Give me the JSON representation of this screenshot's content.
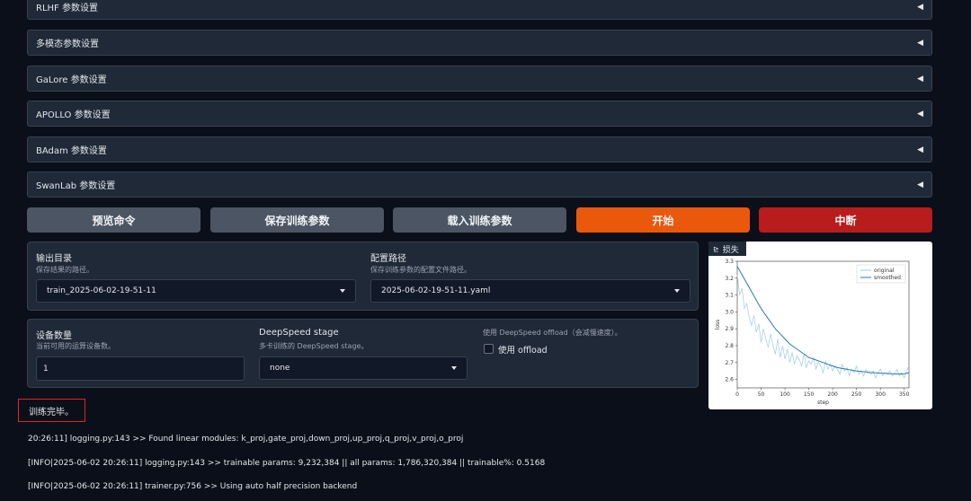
{
  "accordions": [
    {
      "label": "RLHF 参数设置"
    },
    {
      "label": "多模态参数设置"
    },
    {
      "label": "GaLore 参数设置"
    },
    {
      "label": "APOLLO 参数设置"
    },
    {
      "label": "BAdam 参数设置"
    },
    {
      "label": "SwanLab 参数设置"
    }
  ],
  "accordion_arrow": "◀",
  "buttons": {
    "preview": "预览命令",
    "save": "保存训练参数",
    "load": "载入训练参数",
    "start": "开始",
    "abort": "中断"
  },
  "output_dir": {
    "label": "输出目录",
    "info": "保存结果的路径。",
    "value": "train_2025-06-02-19-51-11"
  },
  "config_path": {
    "label": "配置路径",
    "info": "保存训练参数的配置文件路径。",
    "value": "2025-06-02-19-51-11.yaml"
  },
  "device_count": {
    "label": "设备数量",
    "info": "当前可用的运算设备数。",
    "value": "1"
  },
  "ds_stage": {
    "label": "DeepSpeed stage",
    "info": "多卡训练的 DeepSpeed stage。",
    "value": "none"
  },
  "ds_offload": {
    "info": "使用 DeepSpeed offload（会减慢速度）。",
    "label": "使用 offload"
  },
  "plot": {
    "tag": "损失"
  },
  "chart_data": {
    "type": "line",
    "xlabel": "step",
    "ylabel": "loss",
    "xlim": [
      0,
      360
    ],
    "ylim": [
      2.55,
      3.3
    ],
    "xticks": [
      0,
      50,
      100,
      150,
      200,
      250,
      300,
      350
    ],
    "yticks": [
      2.6,
      2.7,
      2.8,
      2.9,
      3.0,
      3.1,
      3.2,
      3.3
    ],
    "legend": "top-right",
    "series": [
      {
        "name": "original",
        "color": "#9ecae1",
        "x": [
          0,
          5,
          10,
          15,
          20,
          25,
          30,
          35,
          40,
          45,
          50,
          55,
          60,
          65,
          70,
          75,
          80,
          85,
          90,
          95,
          100,
          105,
          110,
          115,
          120,
          125,
          130,
          135,
          140,
          145,
          150,
          155,
          160,
          165,
          170,
          175,
          180,
          185,
          190,
          195,
          200,
          205,
          210,
          215,
          220,
          225,
          230,
          235,
          240,
          245,
          250,
          255,
          260,
          265,
          270,
          275,
          280,
          285,
          290,
          295,
          300,
          305,
          310,
          315,
          320,
          325,
          330,
          335,
          340,
          345,
          350,
          355,
          360
        ],
        "values": [
          3.22,
          3.1,
          3.14,
          3.02,
          3.05,
          2.97,
          2.92,
          2.98,
          2.88,
          2.93,
          2.82,
          2.9,
          2.84,
          2.79,
          2.87,
          2.8,
          2.75,
          2.84,
          2.73,
          2.8,
          2.72,
          2.78,
          2.7,
          2.76,
          2.69,
          2.74,
          2.72,
          2.68,
          2.75,
          2.67,
          2.71,
          2.69,
          2.73,
          2.66,
          2.7,
          2.68,
          2.64,
          2.71,
          2.66,
          2.69,
          2.65,
          2.68,
          2.66,
          2.63,
          2.69,
          2.65,
          2.67,
          2.62,
          2.66,
          2.64,
          2.68,
          2.63,
          2.65,
          2.62,
          2.66,
          2.64,
          2.63,
          2.65,
          2.61,
          2.64,
          2.66,
          2.62,
          2.64,
          2.63,
          2.65,
          2.62,
          2.63,
          2.66,
          2.62,
          2.64,
          2.61,
          2.65,
          2.68
        ]
      },
      {
        "name": "smoothed",
        "color": "#2878b5",
        "x": [
          0,
          10,
          20,
          30,
          40,
          50,
          60,
          70,
          80,
          90,
          100,
          110,
          120,
          130,
          140,
          150,
          160,
          170,
          180,
          190,
          200,
          210,
          220,
          230,
          240,
          250,
          260,
          270,
          280,
          290,
          300,
          310,
          320,
          330,
          340,
          350,
          360
        ],
        "values": [
          3.27,
          3.22,
          3.17,
          3.12,
          3.07,
          3.02,
          2.98,
          2.94,
          2.9,
          2.87,
          2.84,
          2.81,
          2.79,
          2.77,
          2.75,
          2.73,
          2.72,
          2.71,
          2.7,
          2.69,
          2.68,
          2.67,
          2.665,
          2.66,
          2.655,
          2.65,
          2.647,
          2.644,
          2.641,
          2.639,
          2.637,
          2.636,
          2.634,
          2.633,
          2.632,
          2.633,
          2.64
        ]
      }
    ]
  },
  "status": "训练完毕。",
  "logs": [
    "20:26:11] logging.py:143 >> Found linear modules: k_proj,gate_proj,down_proj,up_proj,q_proj,v_proj,o_proj",
    "[INFO|2025-06-02 20:26:11] logging.py:143 >> trainable params: 9,232,384 || all params: 1,786,320,384 || trainable%: 0.5168",
    "[INFO|2025-06-02 20:26:11] trainer.py:756 >> Using auto half precision backend"
  ]
}
